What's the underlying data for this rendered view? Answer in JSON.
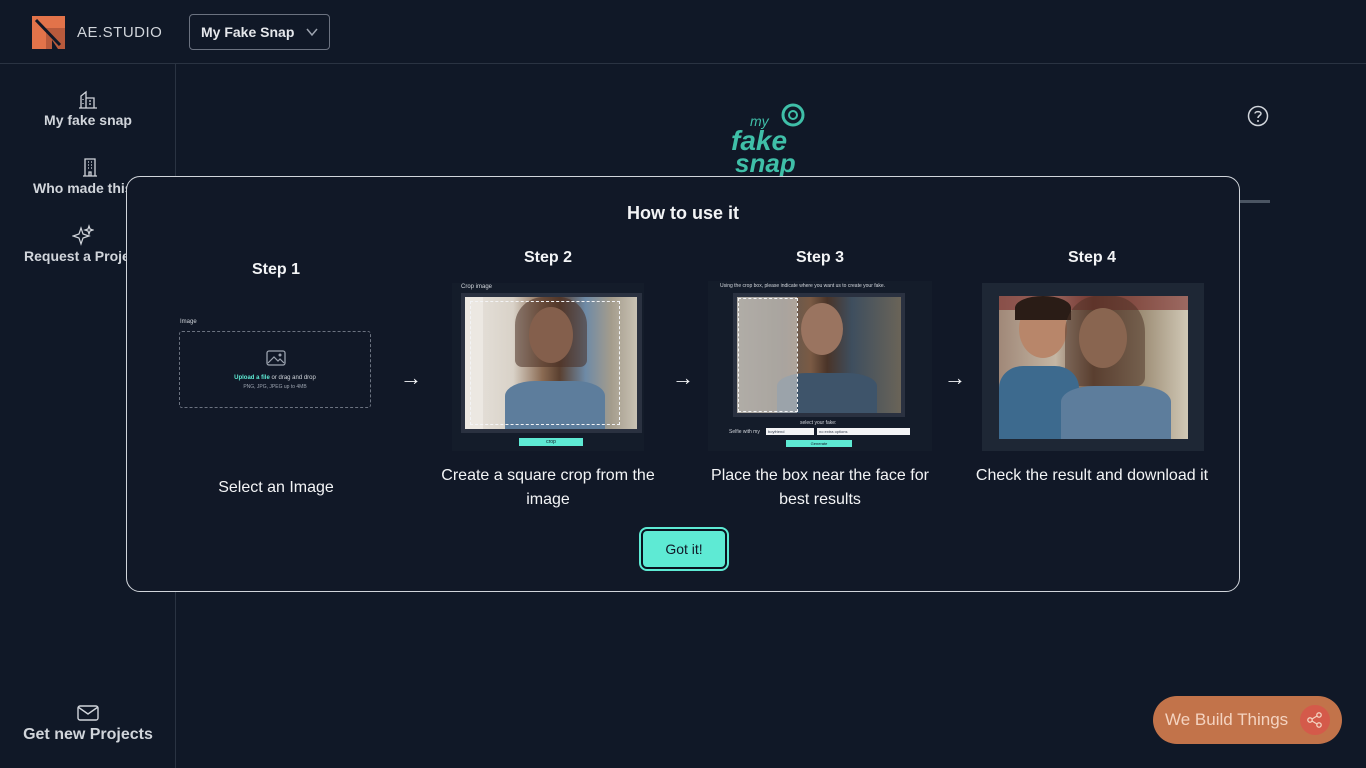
{
  "header": {
    "brand": "AE.STUDIO",
    "project_select": "My Fake Snap"
  },
  "sidebar": {
    "items": [
      {
        "label": "My fake snap",
        "icon": "building-icon"
      },
      {
        "label": "Who made this",
        "icon": "office-icon"
      },
      {
        "label": "Request a Project",
        "icon": "sparkles-icon"
      }
    ],
    "bottom": {
      "label": "Get new Projects",
      "icon": "mail-icon"
    }
  },
  "main": {
    "logo": {
      "line1": "my",
      "line2": "fake",
      "line3": "snap"
    }
  },
  "modal": {
    "title": "How to use it",
    "steps": [
      {
        "title": "Step 1",
        "desc": "Select an Image"
      },
      {
        "title": "Step 2",
        "desc": "Create a square crop from the image"
      },
      {
        "title": "Step 3",
        "desc": "Place the box near the face for best results"
      },
      {
        "title": "Step 4",
        "desc": "Check the result and download it"
      }
    ],
    "arrow": "→",
    "button": "Got it!",
    "step1_mock": {
      "label": "Image",
      "upload_link": "Upload a file",
      "upload_text": " or drag and drop",
      "formats": "PNG, JPG, JPEG up to 4MB"
    },
    "step2_mock": {
      "label": "Crop image",
      "button": "crop"
    },
    "step3_mock": {
      "instruction": "Using the crop box, please indicate where you want us to create your fake.",
      "select_label": "select your fake:",
      "selfie_label": "Selfie with my",
      "option1": "boyfriend",
      "option2": "no extra options",
      "button": "Generate"
    }
  },
  "fab": {
    "label": "We Build Things"
  },
  "colors": {
    "accent": "#5eead4",
    "background": "#101827",
    "fab": "#c2734a"
  }
}
